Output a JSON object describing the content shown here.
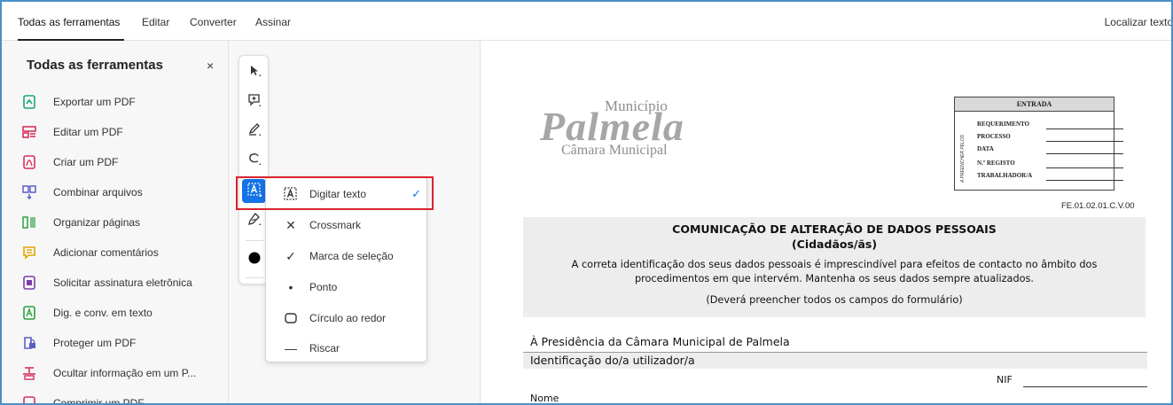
{
  "tabs": [
    "Todas as ferramentas",
    "Editar",
    "Converter",
    "Assinar"
  ],
  "find_text": "Localizar texto",
  "panel": {
    "title": "Todas as ferramentas",
    "close": "×",
    "items": [
      {
        "label": "Exportar um PDF",
        "icon": "export-pdf-icon",
        "color": "#1aa67b"
      },
      {
        "label": "Editar um PDF",
        "icon": "edit-pdf-icon",
        "color": "#d9315b"
      },
      {
        "label": "Criar um PDF",
        "icon": "create-pdf-icon",
        "color": "#d9315b"
      },
      {
        "label": "Combinar arquivos",
        "icon": "combine-files-icon",
        "color": "#5b5fc7"
      },
      {
        "label": "Organizar páginas",
        "icon": "organize-pages-icon",
        "color": "#2e9e3e"
      },
      {
        "label": "Adicionar comentários",
        "icon": "add-comment-icon",
        "color": "#e0a800"
      },
      {
        "label": "Solicitar assinatura eletrônica",
        "icon": "request-signature-icon",
        "color": "#7b3fa8"
      },
      {
        "label": "Dig. e conv. em texto",
        "icon": "scan-ocr-icon",
        "color": "#2e9e3e"
      },
      {
        "label": "Proteger um PDF",
        "icon": "protect-pdf-icon",
        "color": "#5b5fc7"
      },
      {
        "label": "Ocultar informação em um P...",
        "icon": "redact-icon",
        "color": "#d9315b"
      },
      {
        "label": "Comprimir um PDF",
        "icon": "compress-pdf-icon",
        "color": "#d9315b"
      }
    ]
  },
  "popup": {
    "items": [
      {
        "label": "Digitar texto",
        "icon": "text-box-icon",
        "glyph": "[A]",
        "checked": true
      },
      {
        "label": "Crossmark",
        "icon": "cross-icon",
        "glyph": "✕",
        "checked": false
      },
      {
        "label": "Marca de seleção",
        "icon": "check-icon",
        "glyph": "✓",
        "checked": false
      },
      {
        "label": "Ponto",
        "icon": "dot-icon",
        "glyph": "•",
        "checked": false
      },
      {
        "label": "Círculo ao redor",
        "icon": "circle-icon",
        "glyph": "▢",
        "checked": false
      },
      {
        "label": "Riscar",
        "icon": "strike-icon",
        "glyph": "—",
        "checked": false
      }
    ],
    "check_glyph": "✓"
  },
  "document": {
    "logo_top": "Município",
    "logo_main": "Palmela",
    "logo_bottom": "Câmara Municipal",
    "entrada_title": "ENTRADA",
    "entrada_side": "A PREENCHER PELOS",
    "entrada_rows": [
      "REQUERIMENTO",
      "PROCESSO",
      "DATA",
      "N.º REGISTO",
      "TRABALHADOR/A"
    ],
    "code": "FE.01.02.01.C.V.00",
    "title": "COMUNICAÇÃO DE ALTERAÇÃO DE DADOS PESSOAIS",
    "subtitle": "(Cidadãos/ãs)",
    "para1": "A correta identificação dos seus dados pessoais é imprescindível para efeitos de contacto no âmbito dos",
    "para2": "procedimentos em que intervém. Mantenha os seus dados sempre atualizados.",
    "para3": "(Deverá preencher todos os campos do formulário)",
    "addressee": "À Presidência da Câmara Municipal de Palmela",
    "section": "Identificação do/a utilizador/a",
    "nif_label": "NIF",
    "name_label": "Nome"
  },
  "colors": {
    "accent": "#1473e6",
    "highlight": "#d9232b"
  }
}
